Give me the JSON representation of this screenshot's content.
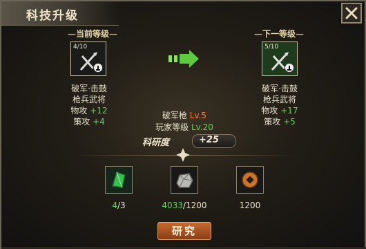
{
  "dialog": {
    "title": "科技升级",
    "close_icon": "close-icon"
  },
  "current": {
    "heading": "当前等级",
    "count": "4/10",
    "skill_name": "破军·击鼓",
    "unit_type": "枪兵武将",
    "physical_attack_label": "物攻",
    "physical_attack_value": "+12",
    "strategy_attack_label": "策攻",
    "strategy_attack_value": "+4"
  },
  "next": {
    "heading": "下一等级",
    "count": "5/10",
    "skill_name": "破军·击鼓",
    "unit_type": "枪兵武将",
    "physical_attack_label": "物攻",
    "physical_attack_value": "+17",
    "strategy_attack_label": "策攻",
    "strategy_attack_value": "+5"
  },
  "requirements": {
    "tech_label": "破军枪",
    "tech_level": "Lv.5",
    "player_label": "玩家等级",
    "player_level": "Lv.20"
  },
  "research_points": {
    "label": "科研度",
    "value": "+25"
  },
  "costs": [
    {
      "icon": "green-crystal-icon",
      "have": "4",
      "need": "/3"
    },
    {
      "icon": "iron-ore-icon",
      "have": "4033",
      "need": "/1200"
    },
    {
      "icon": "copper-coin-icon",
      "have": "",
      "need": "1200"
    }
  ],
  "buttons": {
    "research": "研究"
  },
  "colors": {
    "upgrade_green": "#5fd35a",
    "requirement_orange": "#ff7a33",
    "button_orange": "#c46a2f"
  }
}
